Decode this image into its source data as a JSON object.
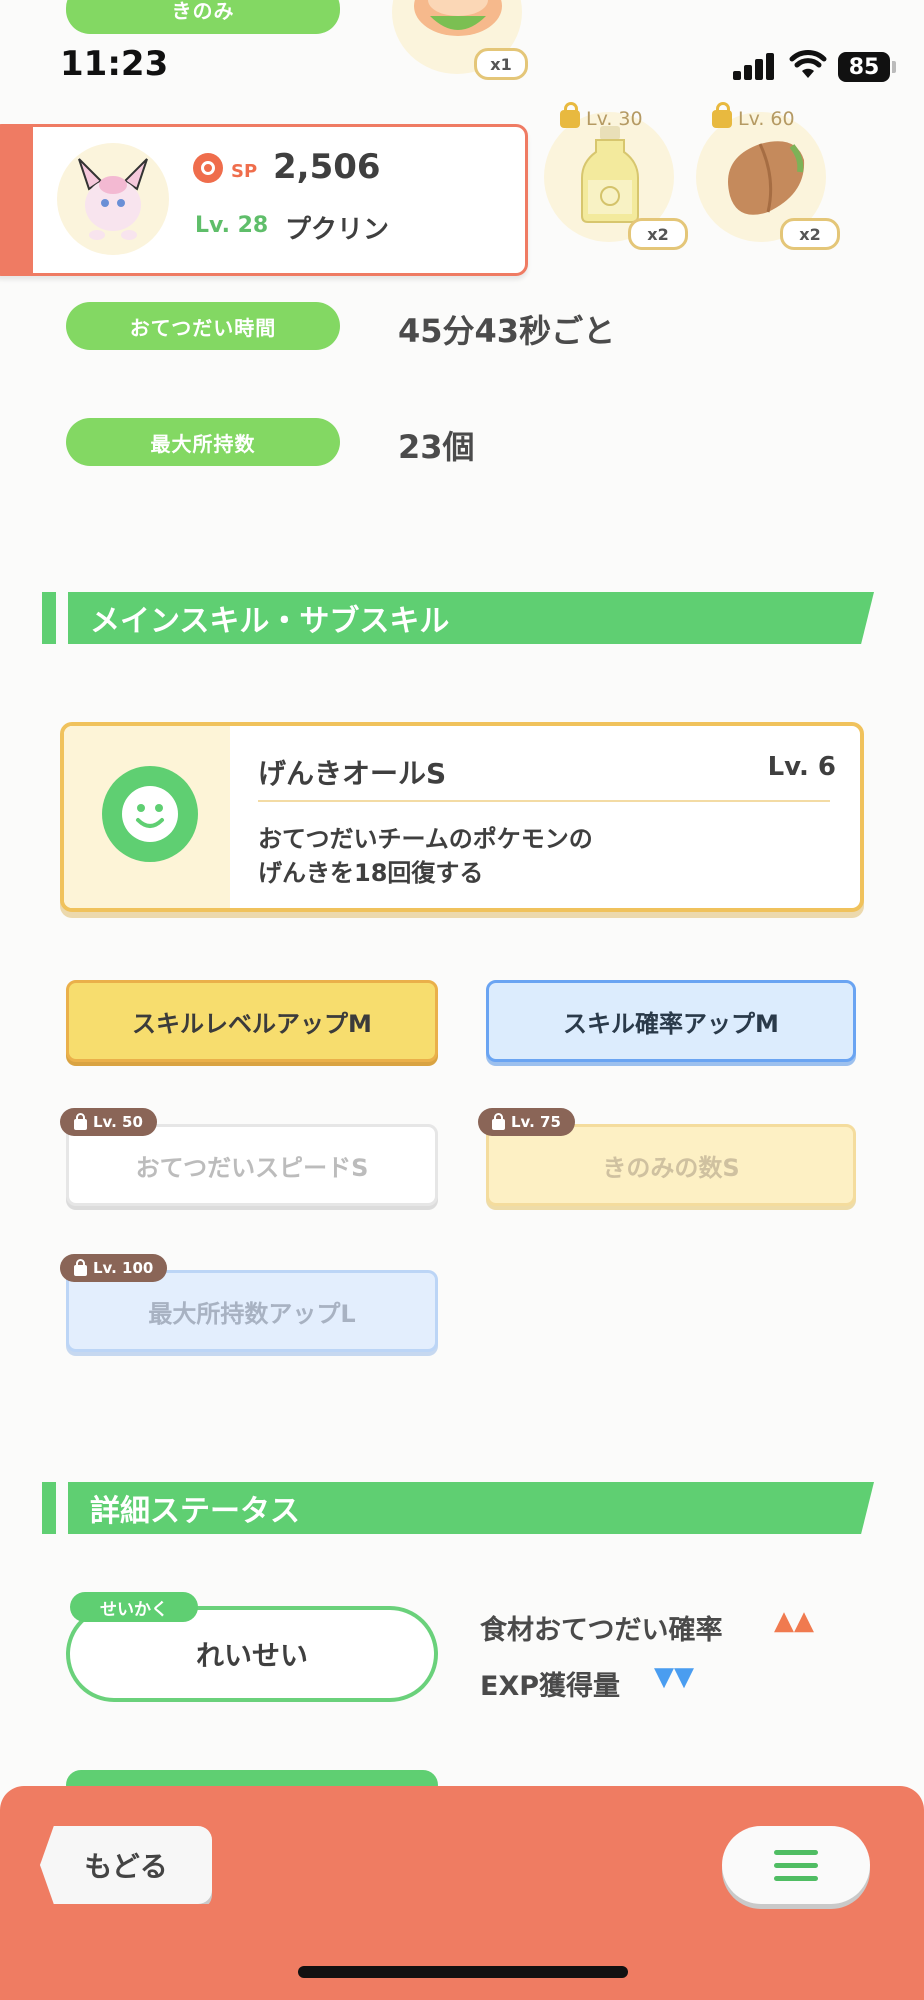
{
  "status_bar": {
    "time": "11:23",
    "battery": "85"
  },
  "top_partial": {
    "label": "きのみ",
    "count": "x1"
  },
  "ingredients": [
    {
      "lock_label": "Lv. 30",
      "count": "x2",
      "icon": "oil-bottle-icon"
    },
    {
      "lock_label": "Lv. 60",
      "count": "x2",
      "icon": "cacao-icon"
    }
  ],
  "pokemon": {
    "sp_label": "SP",
    "sp_value": "2,506",
    "level": "Lv. 28",
    "name": "プクリン"
  },
  "stats": [
    {
      "label": "おてつだい時間",
      "value": "45分43秒ごと"
    },
    {
      "label": "最大所持数",
      "value": "23個"
    }
  ],
  "skill_section": {
    "title": "メインスキル・サブスキル",
    "main_skill": {
      "name": "げんきオールS",
      "level": "Lv. 6",
      "description_line1": "おてつだいチームのポケモンの",
      "description_line2": "げんきを18回復する"
    },
    "sub_skills": [
      {
        "label": "スキルレベルアップM",
        "locked": false,
        "lock_label": ""
      },
      {
        "label": "スキル確率アップM",
        "locked": false,
        "lock_label": ""
      },
      {
        "label": "おてつだいスピードS",
        "locked": true,
        "lock_label": "Lv. 50"
      },
      {
        "label": "きのみの数S",
        "locked": true,
        "lock_label": "Lv. 75"
      },
      {
        "label": "最大所持数アップL",
        "locked": true,
        "lock_label": "Lv. 100"
      }
    ]
  },
  "detail_section": {
    "title": "詳細ステータス",
    "nature_tag": "せいかく",
    "nature": "れいせい",
    "effects": [
      {
        "label": "食材おてつだい確率",
        "direction": "up",
        "arrows": "▲▲",
        "color": "#f07a4f"
      },
      {
        "label": "EXP獲得量",
        "direction": "down",
        "arrows": "▼▼",
        "color": "#4a9df0"
      }
    ]
  },
  "bottom_bar": {
    "back_label": "もどる"
  },
  "colors": {
    "accent_green": "#5fcf72",
    "pill_green": "#83d863",
    "bottom_bar": "#ef7c62",
    "card_border": "#f0c25c"
  }
}
